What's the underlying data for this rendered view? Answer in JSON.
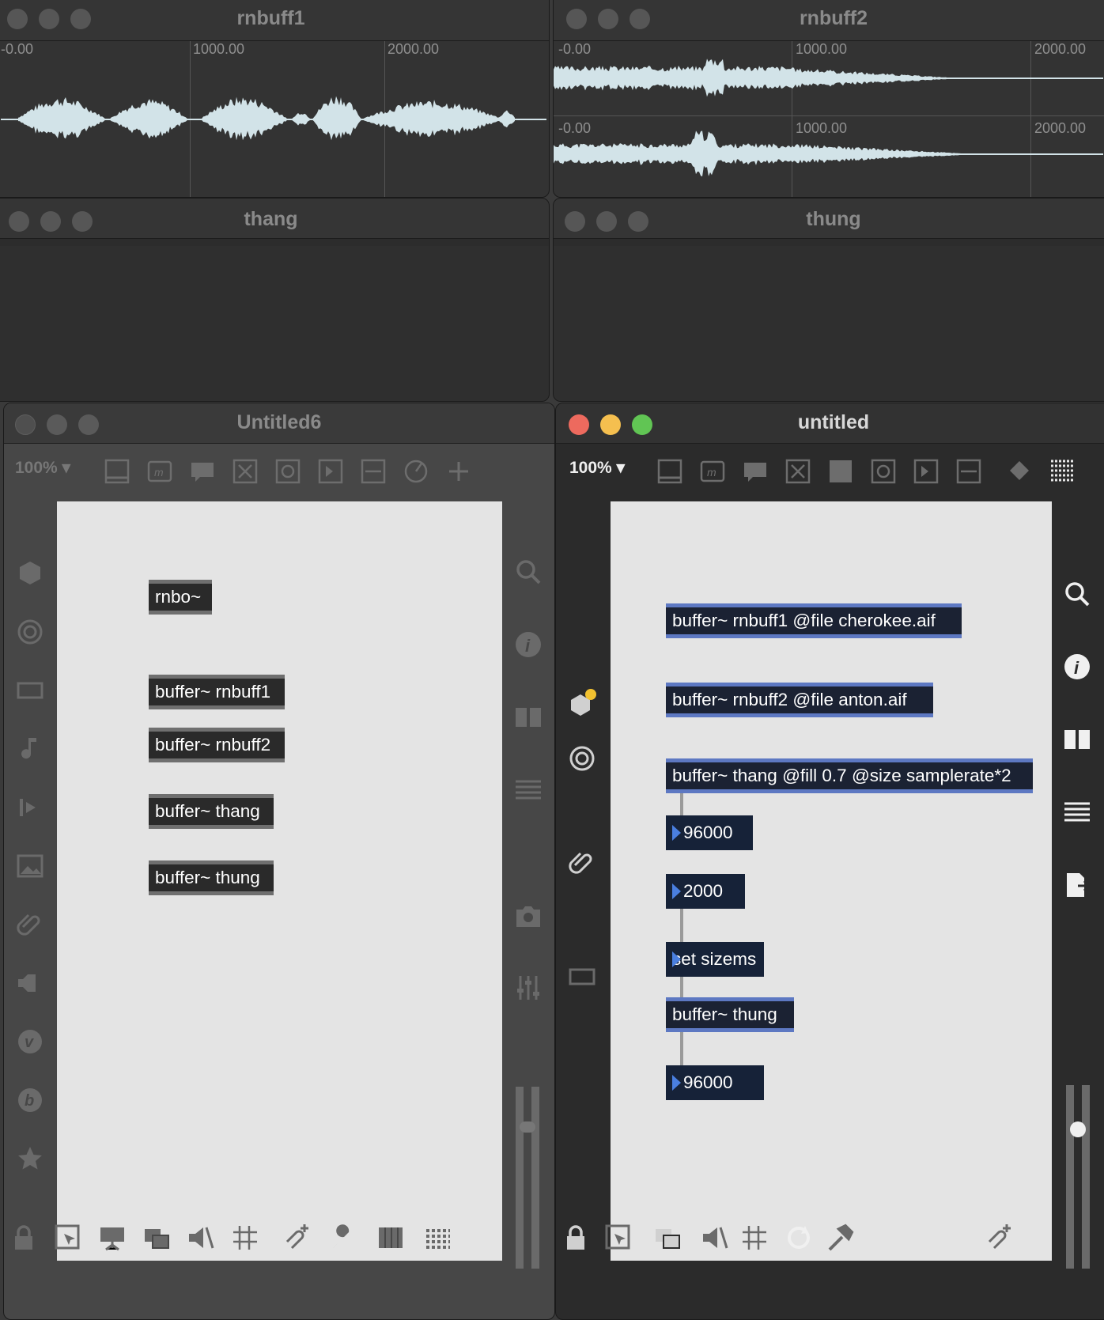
{
  "windows": {
    "rnbuff1": {
      "title": "rnbuff1",
      "ticks": [
        "-0.00",
        "1000.00",
        "2000.00"
      ]
    },
    "rnbuff2": {
      "title": "rnbuff2",
      "ticks_ch1": [
        "-0.00",
        "1000.00",
        "2000.00"
      ],
      "ticks_ch2": [
        "-0.00",
        "1000.00",
        "2000.00"
      ]
    },
    "thang": {
      "title": "thang"
    },
    "thung": {
      "title": "thung"
    },
    "untitled6": {
      "title": "Untitled6",
      "zoom": "100%",
      "objects": {
        "rnbo": "rnbo~",
        "buf_rnbuff1": "buffer~ rnbuff1",
        "buf_rnbuff2": "buffer~ rnbuff2",
        "buf_thang": "buffer~ thang",
        "buf_thung": "buffer~ thung"
      }
    },
    "untitled": {
      "title": "untitled",
      "zoom": "100%",
      "objects": {
        "buf_rnbuff1_file": "buffer~ rnbuff1 @file cherokee.aif",
        "buf_rnbuff2_file": "buffer~ rnbuff2 @file anton.aif",
        "buf_thang_fill": "buffer~ thang @fill 0.7 @size samplerate*2",
        "num1": "96000",
        "num2": "2000",
        "msg_set_sizems": "set sizems",
        "buf_thung": "buffer~ thung",
        "num3": "96000"
      }
    }
  },
  "colors": {
    "waveform": "#d2e3e8",
    "traffic_red": "#ed6a5e",
    "traffic_yellow": "#f5bf4f",
    "traffic_green": "#61c554",
    "number_arrow": "#4a7fe0",
    "selection_blue": "#5d78c2"
  }
}
